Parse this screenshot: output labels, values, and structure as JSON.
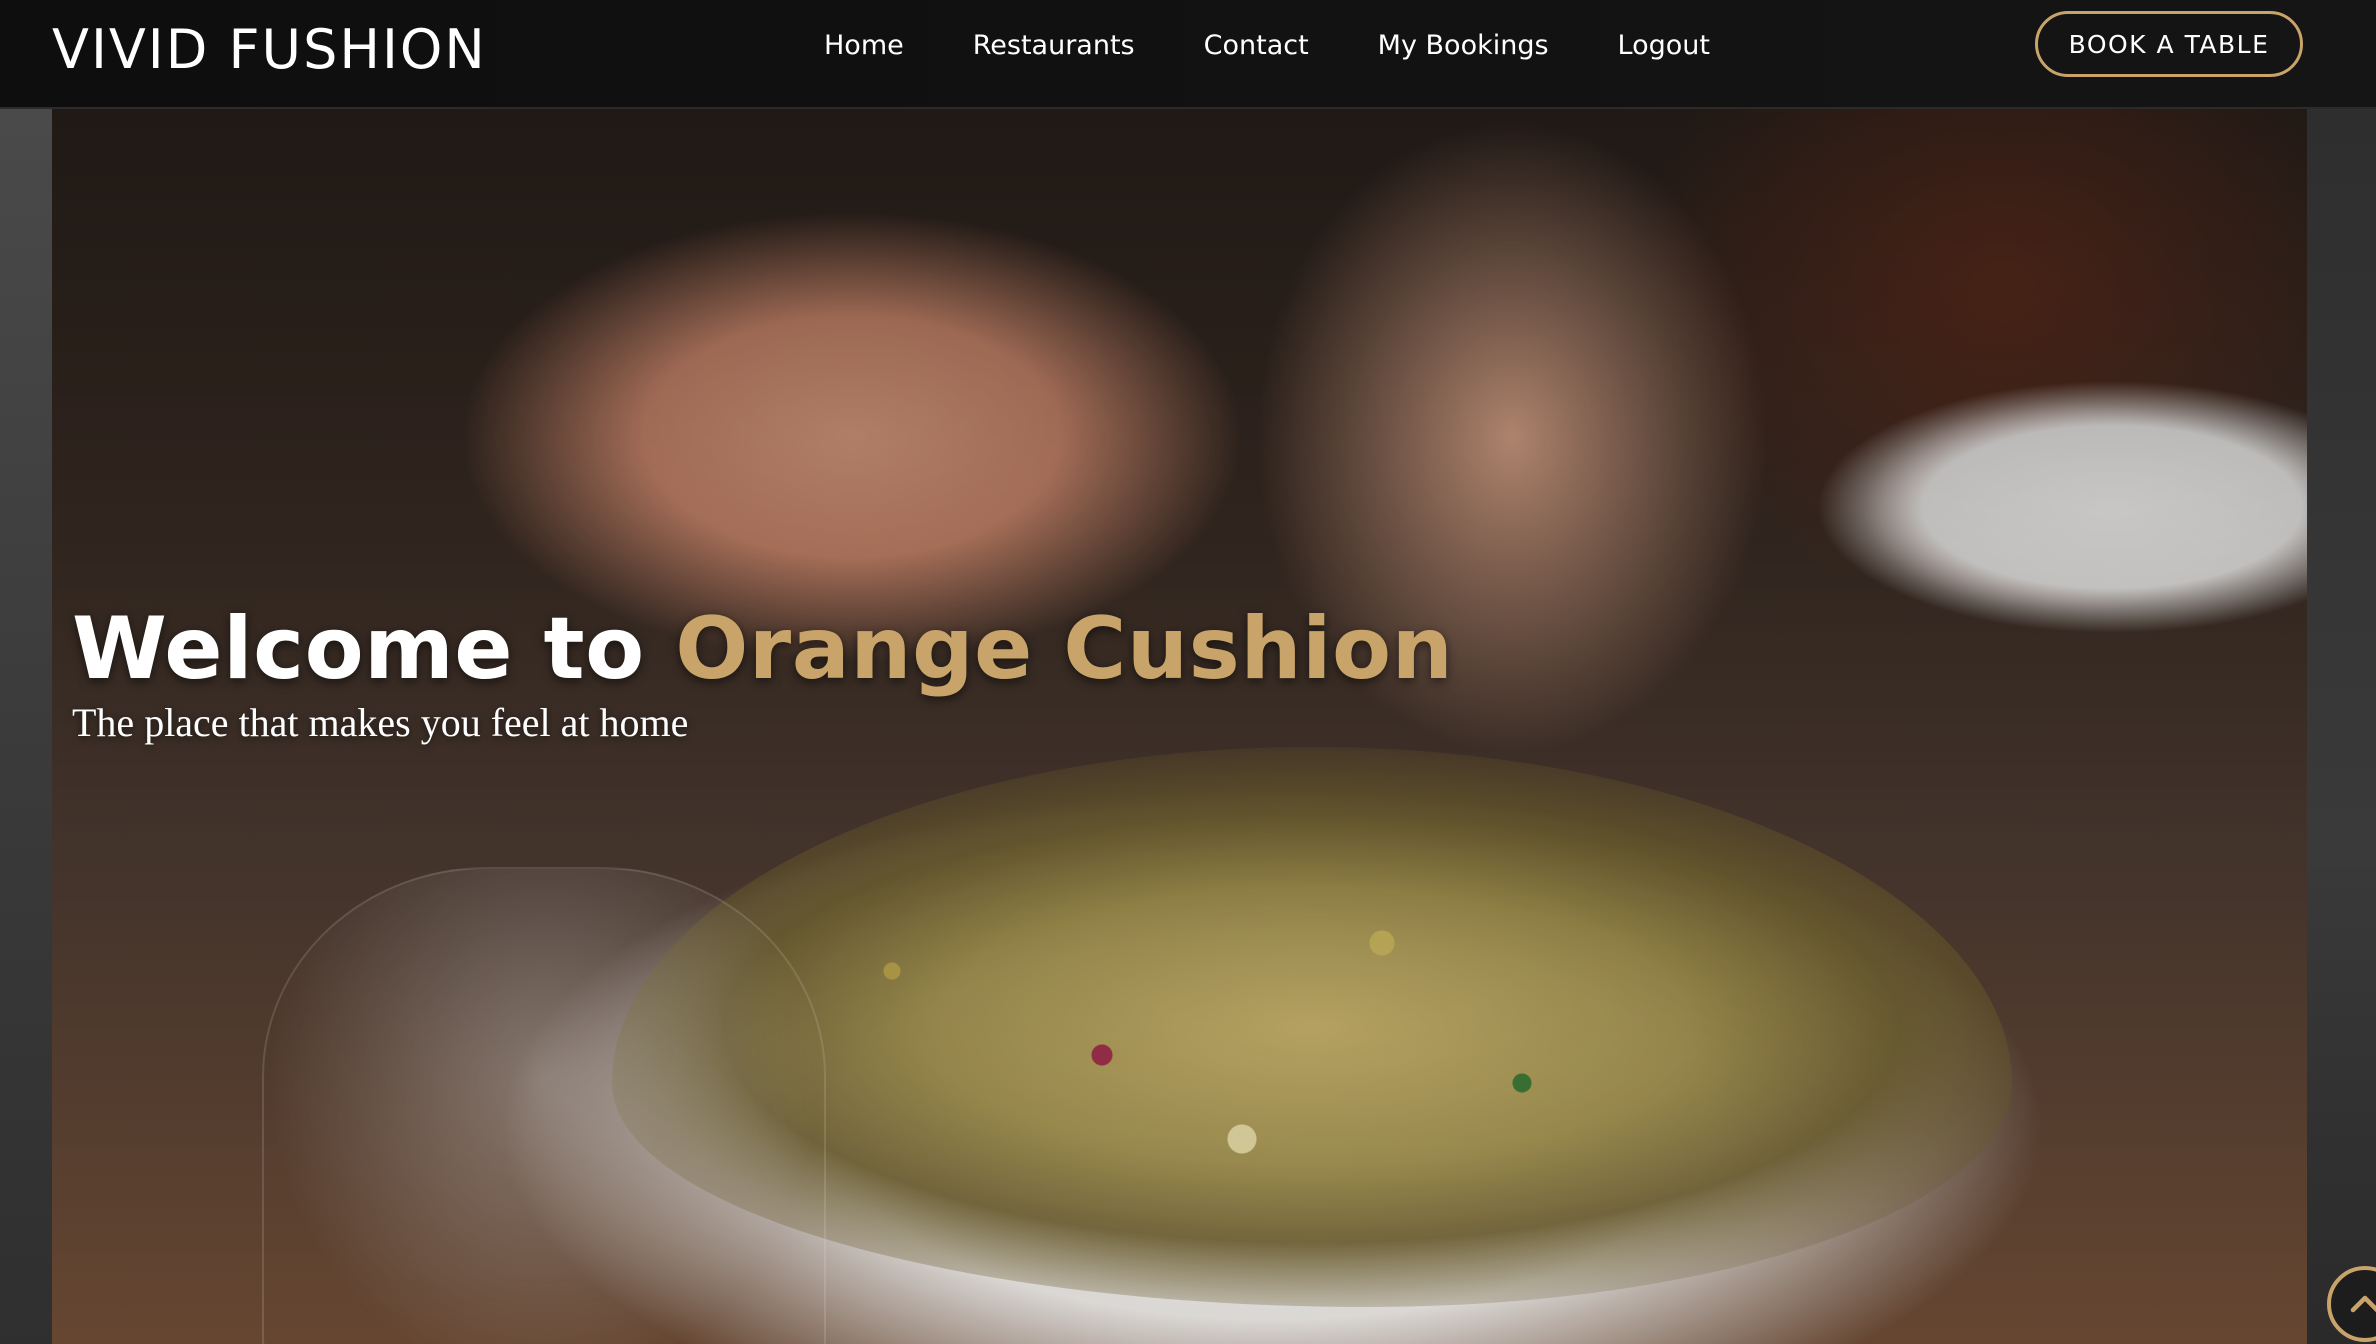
{
  "header": {
    "brand": "VIVID FUSHION",
    "nav": [
      "Home",
      "Restaurants",
      "Contact",
      "My Bookings",
      "Logout"
    ],
    "cta": "BOOK A TABLE"
  },
  "hero": {
    "title_prefix": "Welcome to ",
    "title_accent": "Orange Cushion",
    "subtitle": "The place that makes you feel at home"
  },
  "icons": {
    "scroll_top": "chevron-up-icon"
  },
  "colors": {
    "accent": "#c9a46a",
    "navbar": "#111111",
    "text": "#ffffff"
  }
}
